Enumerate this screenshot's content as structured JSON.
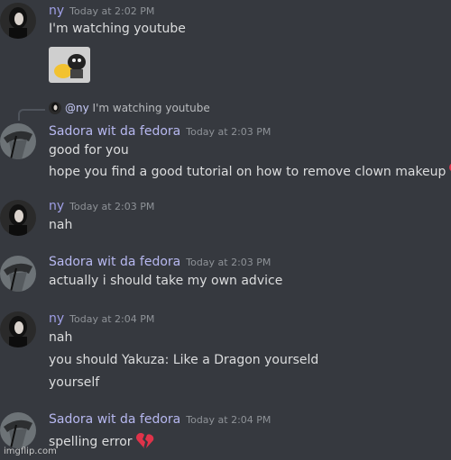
{
  "messages": [
    {
      "author": "ny",
      "timestamp": "Today at 2:02 PM",
      "lines": [
        "I'm watching youtube"
      ],
      "has_attachment": true
    },
    {
      "reply_to": {
        "mention": "@ny",
        "text": "I'm watching youtube"
      },
      "author": "Sadora wit da fedora",
      "timestamp": "Today at 2:03 PM",
      "lines": [
        "good for you",
        "hope you find a good tutorial on how to remove clown makeup"
      ]
    },
    {
      "author": "ny",
      "timestamp": "Today at 2:03 PM",
      "lines": [
        "nah"
      ]
    },
    {
      "author": "Sadora wit da fedora",
      "timestamp": "Today at 2:03 PM",
      "lines": [
        "actually i should take my own advice"
      ]
    },
    {
      "author": "ny",
      "timestamp": "Today at 2:04 PM",
      "lines": [
        "nah",
        "you should Yakuza: Like a Dragon yourseld",
        "yourself"
      ]
    },
    {
      "author": "Sadora wit da fedora",
      "timestamp": "Today at 2:04 PM",
      "lines": [
        "spelling error"
      ]
    }
  ],
  "watermark": "imgflip.com",
  "colors": {
    "background": "#36393f",
    "text": "#dcddde",
    "timestamp": "#8e9297",
    "ny_name": "#9f9fe6",
    "sadora_name": "#b7b8f0",
    "heart": "#e0334a"
  },
  "icons": [
    "red-heart-icon",
    "broken-heart-icon"
  ]
}
